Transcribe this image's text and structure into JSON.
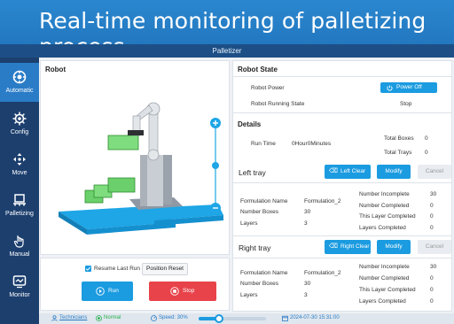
{
  "banner": {
    "title": "Real-time monitoring of palletizing process"
  },
  "window": {
    "title": "Palletizer"
  },
  "sidebar": {
    "items": [
      {
        "label": "Automatic",
        "icon": "automatic-icon"
      },
      {
        "label": "Config",
        "icon": "config-icon"
      },
      {
        "label": "Move",
        "icon": "move-icon"
      },
      {
        "label": "Palletizing",
        "icon": "palletizing-icon"
      },
      {
        "label": "Manual",
        "icon": "manual-icon"
      },
      {
        "label": "Monitor",
        "icon": "monitor-icon"
      }
    ],
    "active": "Automatic"
  },
  "robot_panel": {
    "title": "Robot"
  },
  "controls": {
    "resume_last_run": "Resume Last Run",
    "resume_checked": true,
    "position_reset": "Position Reset",
    "run": "Run",
    "stop": "Stop"
  },
  "robot_state": {
    "title": "Robot State",
    "power_label": "Robot Power",
    "power_button": "Power Off",
    "running_label": "Robot Running State",
    "running_value": "Stop"
  },
  "details": {
    "title": "Details",
    "run_time_label": "Run Time",
    "run_time_value": "0Hour0Minutes",
    "total_boxes_label": "Total Boxes",
    "total_boxes_value": "0",
    "total_trays_label": "Total Trays",
    "total_trays_value": "0"
  },
  "left_tray": {
    "title": "Left tray",
    "clear": "Left Clear",
    "modify": "Modify",
    "cancel": "Cancel",
    "formulation_label": "Formulation Name",
    "formulation_value": "Formulation_2",
    "boxes_label": "Number Boxes",
    "boxes_value": "30",
    "layers_label": "Layers",
    "layers_value": "3",
    "incomplete_label": "Number Incomplete",
    "incomplete_value": "30",
    "completed_label": "Number Completed",
    "completed_value": "0",
    "layer_completed_label": "This Layer Completed",
    "layer_completed_value": "0",
    "layers_completed_label": "Layers Completed",
    "layers_completed_value": "0"
  },
  "right_tray": {
    "title": "Right tray",
    "clear": "Right Clear",
    "modify": "Modify",
    "cancel": "Cancel",
    "formulation_label": "Formulation Name",
    "formulation_value": "Formulation_2",
    "boxes_label": "Number Boxes",
    "boxes_value": "30",
    "layers_label": "Layers",
    "layers_value": "3",
    "incomplete_label": "Number Incomplete",
    "incomplete_value": "30",
    "completed_label": "Number Completed",
    "completed_value": "0",
    "layer_completed_label": "This Layer Completed",
    "layer_completed_value": "0",
    "layers_completed_label": "Layers Completed",
    "layers_completed_value": "0"
  },
  "status": {
    "user": "Technicians",
    "mode": "Normal",
    "speed": "Speed: 30%",
    "speed_fraction": 0.3,
    "datetime": "2024-07-30 15:31:00"
  },
  "colors": {
    "accent": "#1b9be0",
    "stop": "#e8434a",
    "nav": "#1c3f6e",
    "green_box": "#6bd06b"
  }
}
